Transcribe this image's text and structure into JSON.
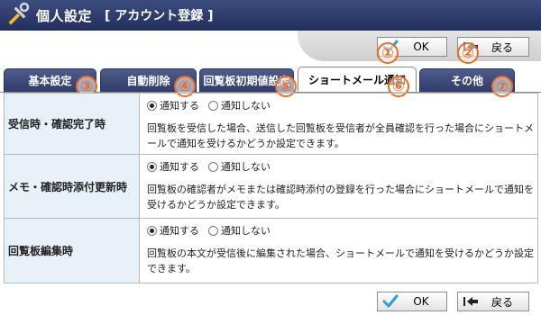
{
  "header": {
    "title": "個人設定",
    "subtitle": "[ アカウント登録 ]",
    "icon": "tools-icon"
  },
  "buttons": {
    "ok_label": "OK",
    "back_label": "戻る"
  },
  "tabs": [
    {
      "label": "基本設定",
      "marker": "③",
      "active": false
    },
    {
      "label": "自動削除",
      "marker": "④",
      "active": false
    },
    {
      "label": "回覧板初期値設定",
      "marker": "⑤",
      "active": false
    },
    {
      "label": "ショートメール通知",
      "marker": "⑥",
      "active": true
    },
    {
      "label": "その他",
      "marker": "⑦",
      "active": false
    }
  ],
  "markers": {
    "ok": "①",
    "back": "②"
  },
  "radio": {
    "notify": "通知する",
    "no_notify": "通知しない"
  },
  "rows": [
    {
      "label": "受信時・確認完了時",
      "selected": "notify",
      "desc": "回覧板を受信した場合、送信した回覧板を受信者が全員確認を行った場合にショートメールで通知を受けるかどうか設定できます。"
    },
    {
      "label": "メモ・確認時添付更新時",
      "selected": "notify",
      "desc": "回覧板の確認者がメモまたは確認時添付の登録を行った場合にショートメールで通知を受けるかどうか設定できます。"
    },
    {
      "label": "回覧板編集時",
      "selected": "notify",
      "desc": "回覧板の本文が受信後に編集された場合、ショートメールで通知を受けるかどうか設定できます。"
    }
  ],
  "colors": {
    "header": "#2c3a6a",
    "tab": "#3d4a7a",
    "label_bg": "#e8f0f8",
    "marker": "#ee6b1f",
    "ok_check": "#2a9fd8"
  }
}
